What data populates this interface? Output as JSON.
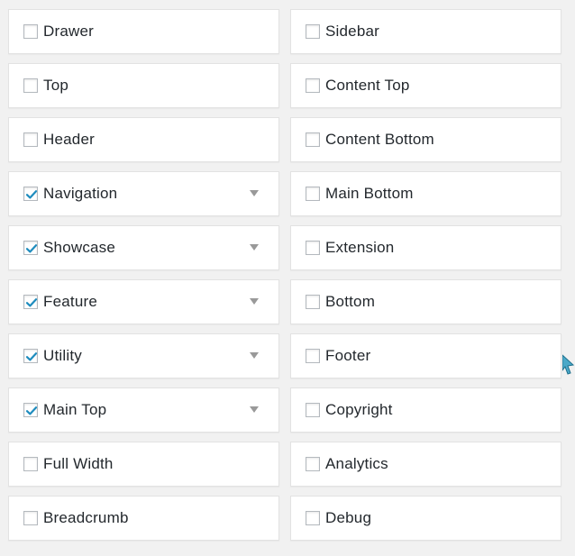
{
  "left_column": [
    {
      "label": "Drawer",
      "checked": false,
      "expandable": false
    },
    {
      "label": "Top",
      "checked": false,
      "expandable": false
    },
    {
      "label": "Header",
      "checked": false,
      "expandable": false
    },
    {
      "label": "Navigation",
      "checked": true,
      "expandable": true
    },
    {
      "label": "Showcase",
      "checked": true,
      "expandable": true
    },
    {
      "label": "Feature",
      "checked": true,
      "expandable": true
    },
    {
      "label": "Utility",
      "checked": true,
      "expandable": true
    },
    {
      "label": "Main Top",
      "checked": true,
      "expandable": true
    },
    {
      "label": "Full Width",
      "checked": false,
      "expandable": false
    },
    {
      "label": "Breadcrumb",
      "checked": false,
      "expandable": false
    }
  ],
  "right_column": [
    {
      "label": "Sidebar",
      "checked": false,
      "expandable": false
    },
    {
      "label": "Content Top",
      "checked": false,
      "expandable": false
    },
    {
      "label": "Content Bottom",
      "checked": false,
      "expandable": false
    },
    {
      "label": "Main Bottom",
      "checked": false,
      "expandable": false
    },
    {
      "label": "Extension",
      "checked": false,
      "expandable": false
    },
    {
      "label": "Bottom",
      "checked": false,
      "expandable": false
    },
    {
      "label": "Footer",
      "checked": false,
      "expandable": false
    },
    {
      "label": "Copyright",
      "checked": false,
      "expandable": false
    },
    {
      "label": "Analytics",
      "checked": false,
      "expandable": false
    },
    {
      "label": "Debug",
      "checked": false,
      "expandable": false
    }
  ],
  "colors": {
    "check": "#1e8cbe",
    "arrow": "#999999",
    "panel_bg": "#ffffff",
    "page_bg": "#f1f1f1"
  },
  "icons": {
    "checkmark": "checkmark-icon",
    "expand": "triangle-down-icon",
    "cursor": "mouse-pointer-icon"
  }
}
